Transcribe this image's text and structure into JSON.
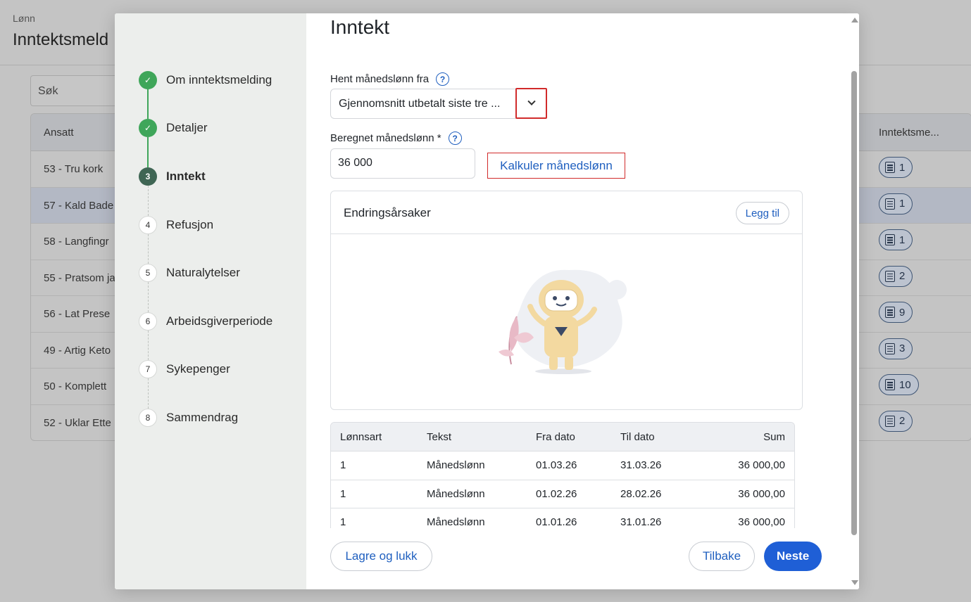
{
  "background": {
    "breadcrumb": "Lønn",
    "title": "Inntektsmeld",
    "search_placeholder": "Søk",
    "table": {
      "col_left": "Ansatt",
      "col_right": "Inntektsme...",
      "rows": [
        {
          "name": "53 - Tru kork",
          "count": "1"
        },
        {
          "name": "57 - Kald Bade",
          "count": "1"
        },
        {
          "name": "58 - Langfingr",
          "count": "1"
        },
        {
          "name": "55 - Pratsom ja",
          "count": "2"
        },
        {
          "name": "56 - Lat Prese",
          "count": "9"
        },
        {
          "name": "49 - Artig Keto",
          "count": "3"
        },
        {
          "name": "50 - Komplett",
          "count": "10"
        },
        {
          "name": "52 - Uklar Ette",
          "count": "2"
        }
      ]
    }
  },
  "stepper": {
    "steps": [
      {
        "number": "1",
        "label": "Om inntektsmelding",
        "state": "done"
      },
      {
        "number": "2",
        "label": "Detaljer",
        "state": "done"
      },
      {
        "number": "3",
        "label": "Inntekt",
        "state": "active"
      },
      {
        "number": "4",
        "label": "Refusjon",
        "state": "todo"
      },
      {
        "number": "5",
        "label": "Naturalytelser",
        "state": "todo"
      },
      {
        "number": "6",
        "label": "Arbeidsgiverperiode",
        "state": "todo"
      },
      {
        "number": "7",
        "label": "Sykepenger",
        "state": "todo"
      },
      {
        "number": "8",
        "label": "Sammendrag",
        "state": "todo"
      }
    ]
  },
  "form": {
    "heading": "Inntekt",
    "source_label": "Hent månedslønn fra",
    "source_value": "Gjennomsnitt utbetalt siste tre ...",
    "salary_label": "Beregnet månedslønn *",
    "salary_value": "36 000",
    "calculate_label": "Kalkuler månedslønn",
    "help_glyph": "?"
  },
  "changes_card": {
    "title": "Endringsårsaker",
    "add_label": "Legg til"
  },
  "salary_table": {
    "headers": [
      "Lønnsart",
      "Tekst",
      "Fra dato",
      "Til dato",
      "Sum"
    ],
    "rows": [
      [
        "1",
        "Månedslønn",
        "01.03.26",
        "31.03.26",
        "36 000,00"
      ],
      [
        "1",
        "Månedslønn",
        "01.02.26",
        "28.02.26",
        "36 000,00"
      ],
      [
        "1",
        "Månedslønn",
        "01.01.26",
        "31.01.26",
        "36 000,00"
      ]
    ]
  },
  "footer": {
    "save_close": "Lagre og lukk",
    "back": "Tilbake",
    "next": "Neste"
  },
  "colors": {
    "accent": "#1f5fd6",
    "done": "#3fa65a",
    "active_step": "#3f6654",
    "highlight_border": "#d12b2b"
  }
}
